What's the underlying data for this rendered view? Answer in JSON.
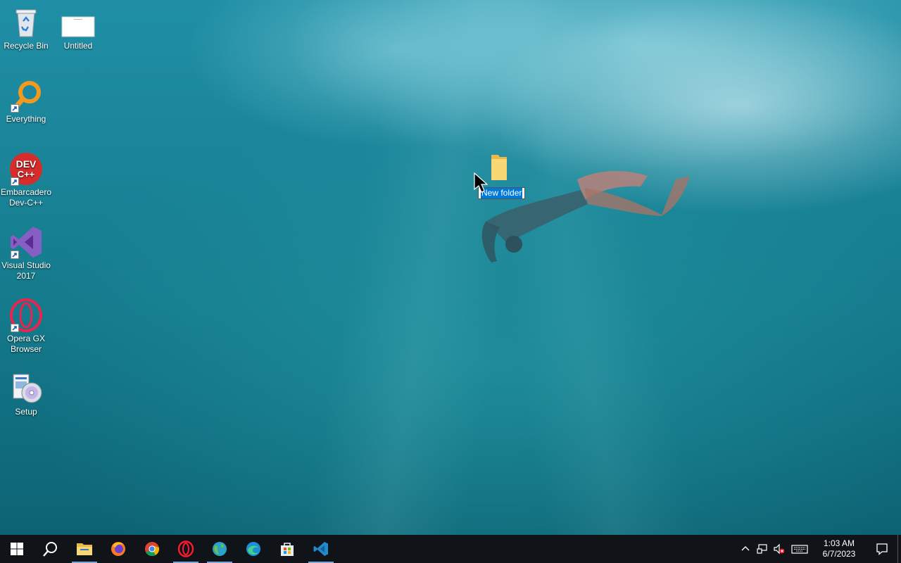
{
  "desktop": {
    "icons": [
      {
        "label": "Recycle Bin",
        "icon": "recycle-bin-icon",
        "shortcut": false
      },
      {
        "label": "Untitled",
        "icon": "document-icon",
        "shortcut": false
      },
      {
        "label": "Everything",
        "icon": "everything-search-icon",
        "shortcut": true
      },
      {
        "label": "Embarcadero Dev-C++",
        "icon": "devcpp-icon",
        "shortcut": true
      },
      {
        "label": "Visual Studio 2017",
        "icon": "visual-studio-icon",
        "shortcut": true
      },
      {
        "label": "Opera GX Browser",
        "icon": "opera-gx-icon",
        "shortcut": true
      },
      {
        "label": "Setup",
        "icon": "setup-icon",
        "shortcut": false
      }
    ],
    "new_folder": {
      "value": "New folder",
      "icon": "folder-icon"
    },
    "devcpp_badge": {
      "line1": "DEV",
      "line2": "C++"
    }
  },
  "taskbar": {
    "buttons": [
      {
        "name": "start-button",
        "icon": "windows-logo-icon",
        "active": false
      },
      {
        "name": "search-button",
        "icon": "search-icon",
        "active": false
      },
      {
        "name": "file-explorer-button",
        "icon": "file-explorer-icon",
        "active": true
      },
      {
        "name": "firefox-button",
        "icon": "firefox-icon",
        "active": false
      },
      {
        "name": "chrome-button",
        "icon": "chrome-icon",
        "active": false
      },
      {
        "name": "opera-button",
        "icon": "opera-icon",
        "active": true
      },
      {
        "name": "globe-app-button",
        "icon": "globe-icon",
        "active": true
      },
      {
        "name": "edge-button",
        "icon": "edge-icon",
        "active": false
      },
      {
        "name": "store-button",
        "icon": "store-icon",
        "active": false
      },
      {
        "name": "vscode-button",
        "icon": "vscode-icon",
        "active": true
      }
    ],
    "tray": {
      "icons": [
        "chevron-up-icon",
        "network-icon",
        "volume-muted-icon",
        "keyboard-icon"
      ],
      "time": "1:03 AM",
      "date": "6/7/2023",
      "notification_icon": "action-center-icon"
    }
  },
  "colors": {
    "taskbar_bg": "#101418",
    "selection": "#0078d7",
    "active_indicator": "#7aa7d8"
  }
}
